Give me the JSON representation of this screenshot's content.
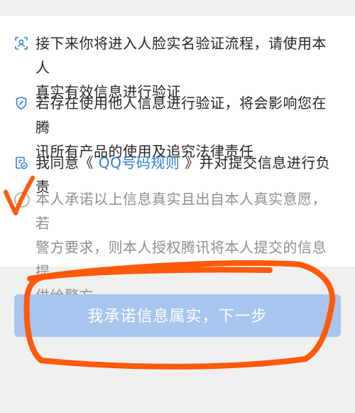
{
  "items": [
    {
      "icon": "face-scan-icon",
      "line1": "接下来你将进入人脸实名验证流程，请使用本人",
      "line2": "真实有效信息进行验证"
    },
    {
      "icon": "shield-icon",
      "line1": "若存在使用他人信息进行验证，将会影响您在腾",
      "line2": "讯所有产品的使用及追究法律责任"
    }
  ],
  "agreement": {
    "icon": "document-check-icon",
    "prefix": "我同意《 ",
    "link": "QQ号码规则",
    "suffix": " 》并对提交信息进行负责"
  },
  "promise": {
    "line1": "本人承诺以上信息真实且出自本人真实意愿，若",
    "line2": "警方要求，则本人授权腾讯将本人提交的信息提",
    "line3": "供给警方。"
  },
  "next_button_label": "我承诺信息属实，下一步",
  "colors": {
    "accent": "#2f7fd6",
    "button_disabled": "#a8c5ee",
    "annotation": "#ff5a0a"
  }
}
